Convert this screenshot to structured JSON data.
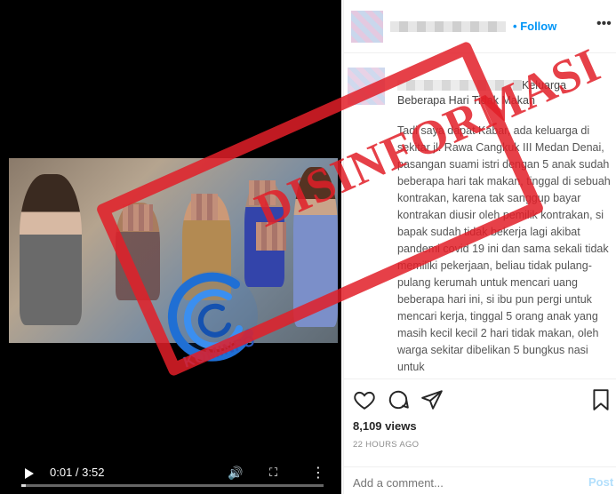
{
  "video": {
    "current_time": "0:01",
    "duration": "3:52",
    "time_display": "0:01 / 3:52",
    "progress_fraction": 0.004,
    "logo_text": "KOMINFO"
  },
  "post": {
    "header": {
      "follow_label": "Follow",
      "follow_separator": "•"
    },
    "caption": {
      "title_tail": "Keluarga Beberapa Hari Tidak Makan",
      "body": "Tadi saya dapat Kabar, ada keluarga di sekitar jl. Rawa Cangkuk III Medan Denai, pasangan suami istri dengan 5 anak sudah beberapa hari tak makan, tinggal di sebuah kontrakan, karena tak sanggup bayar kontrakan diusir oleh pemilik kontrakan, si bapak sudah tidak bekerja lagi akibat pandemi covid 19 ini dan sama sekali tidak memiliki pekerjaan, beliau tidak pulang-pulang kerumah untuk mencari uang beberapa hari ini, si ibu pun pergi untuk mencari kerja, tinggal 5 orang anak yang masih kecil kecil 2 hari tidak makan, oleh warga sekitar dibelikan 5 bungkus nasi untuk"
    },
    "views": "8,109 views",
    "time_ago": "22 HOURS AGO",
    "comment_placeholder": "Add a comment...",
    "post_label": "Post"
  },
  "stamp": {
    "text": "DISINFORMASI",
    "color": "#e21e28"
  },
  "icons": [
    "play-icon",
    "volume-icon",
    "fullscreen-icon",
    "more-icon",
    "heart-icon",
    "comment-icon",
    "share-icon",
    "bookmark-icon",
    "options-icon"
  ]
}
